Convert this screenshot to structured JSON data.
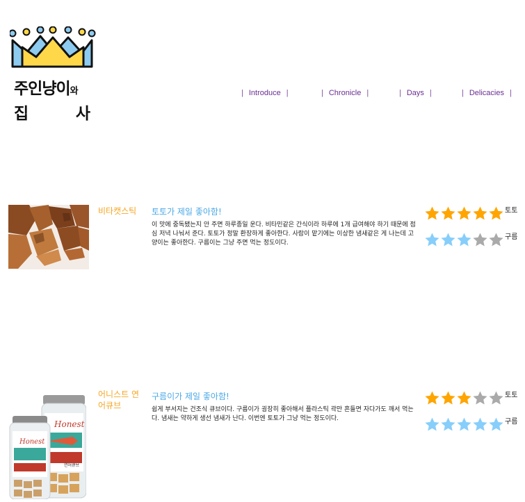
{
  "logo": {
    "line1": "주인냥이",
    "line1_small": "와",
    "line2_left": "집",
    "line2_right": "사"
  },
  "nav": {
    "separator": "|",
    "items": [
      {
        "label": "Introduce"
      },
      {
        "label": "Chronicle"
      },
      {
        "label": "Days"
      },
      {
        "label": "Delicacies"
      }
    ]
  },
  "colors": {
    "accent_orange": "#f5a623",
    "accent_blue": "#4aa8e6",
    "star_orange": "#ffa500",
    "star_blue": "#87cefa",
    "star_gray": "#aaaaaa",
    "nav_purple": "#6a2d91"
  },
  "products": [
    {
      "name": "비타캣스틱",
      "title": "토토가 제일 좋아함!",
      "description": "이 맛에 중독됐는지 안 주면 하루종일 운다. 비타민같은 간식이라 하루에 1개 급여해야 하기 때문에 점심 저녁 나눠서 준다. 토토가 정말 환장하게 좋아한다. 사람이 맡기에는 이상한 냄새같은 게 나는데 고양이는 좋아한다. 구름이는 그냥 주면 먹는 정도이다.",
      "ratings": [
        {
          "rater": "토토",
          "score": 5,
          "max": 5,
          "color": "orange"
        },
        {
          "rater": "구름",
          "score": 3,
          "max": 5,
          "color": "blue"
        }
      ]
    },
    {
      "name": "어니스트 연어큐브",
      "title": "구름이가 제일 좋아함!",
      "description": "쉽게 부서지는 건조식 큐브이다. 구름이가 굉장히 좋아해서 플라스틱 곽만 흔들면 자다가도 깨서 먹는다. 냄새는 약하게 생선 냄새가 난다. 이번엔 토토가 그냥 먹는 정도이다.",
      "ratings": [
        {
          "rater": "토토",
          "score": 3,
          "max": 5,
          "color": "orange"
        },
        {
          "rater": "구름",
          "score": 5,
          "max": 5,
          "color": "blue"
        }
      ],
      "image_labels": {
        "brand": "Honest",
        "product": "연어큐브"
      }
    }
  ]
}
